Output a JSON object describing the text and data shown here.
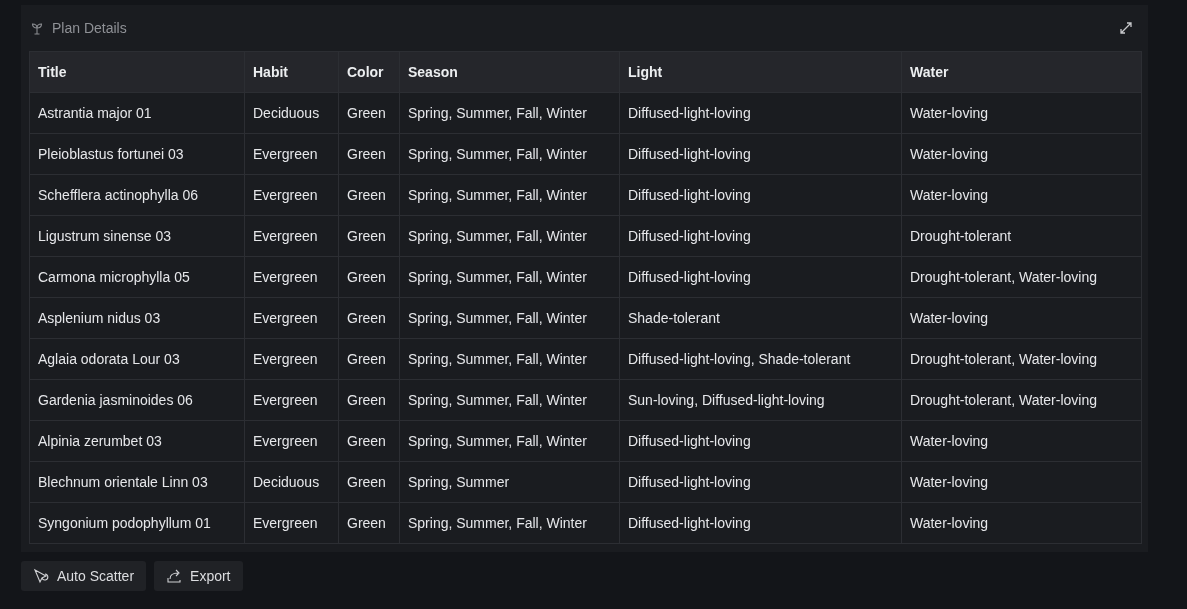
{
  "panel": {
    "title": "Plan Details"
  },
  "table": {
    "columns": [
      "Title",
      "Habit",
      "Color",
      "Season",
      "Light",
      "Water"
    ],
    "rows": [
      [
        "Astrantia major 01",
        "Deciduous",
        "Green",
        "Spring, Summer, Fall, Winter",
        "Diffused-light-loving",
        "Water-loving"
      ],
      [
        "Pleioblastus fortunei 03",
        "Evergreen",
        "Green",
        "Spring, Summer, Fall, Winter",
        "Diffused-light-loving",
        "Water-loving"
      ],
      [
        "Schefflera actinophylla 06",
        "Evergreen",
        "Green",
        "Spring, Summer, Fall, Winter",
        "Diffused-light-loving",
        "Water-loving"
      ],
      [
        "Ligustrum sinense 03",
        "Evergreen",
        "Green",
        "Spring, Summer, Fall, Winter",
        "Diffused-light-loving",
        "Drought-tolerant"
      ],
      [
        "Carmona microphylla 05",
        "Evergreen",
        "Green",
        "Spring, Summer, Fall, Winter",
        "Diffused-light-loving",
        "Drought-tolerant, Water-loving"
      ],
      [
        "Asplenium nidus 03",
        "Evergreen",
        "Green",
        "Spring, Summer, Fall, Winter",
        "Shade-tolerant",
        "Water-loving"
      ],
      [
        "Aglaia odorata Lour 03",
        "Evergreen",
        "Green",
        "Spring, Summer, Fall, Winter",
        "Diffused-light-loving, Shade-tolerant",
        "Drought-tolerant, Water-loving"
      ],
      [
        "Gardenia jasminoides 06",
        "Evergreen",
        "Green",
        "Spring, Summer, Fall, Winter",
        "Sun-loving, Diffused-light-loving",
        "Drought-tolerant, Water-loving"
      ],
      [
        "Alpinia zerumbet 03",
        "Evergreen",
        "Green",
        "Spring, Summer, Fall, Winter",
        "Diffused-light-loving",
        "Water-loving"
      ],
      [
        "Blechnum orientale Linn 03",
        "Deciduous",
        "Green",
        "Spring, Summer",
        "Diffused-light-loving",
        "Water-loving"
      ],
      [
        "Syngonium podophyllum 01",
        "Evergreen",
        "Green",
        "Spring, Summer, Fall, Winter",
        "Diffused-light-loving",
        "Water-loving"
      ]
    ]
  },
  "actions": [
    {
      "kind": "scatter",
      "label": "Auto Scatter"
    },
    {
      "kind": "export",
      "label": "Export"
    }
  ]
}
